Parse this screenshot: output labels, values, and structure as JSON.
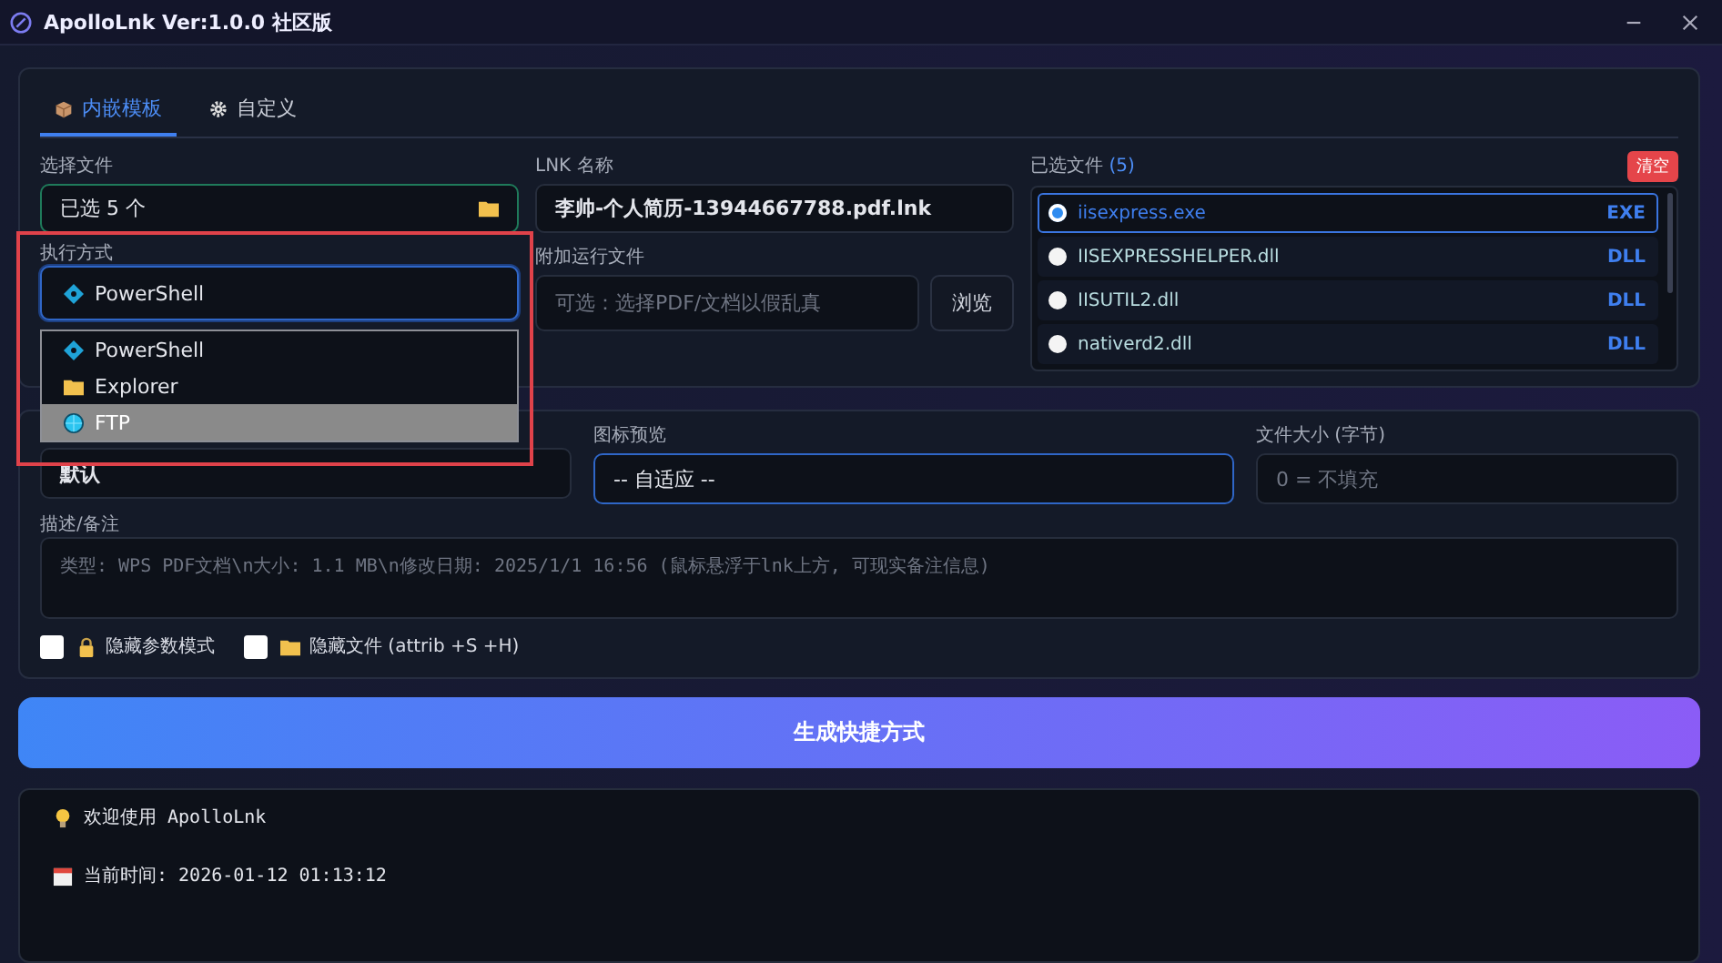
{
  "window": {
    "title": "ApolloLnk Ver:1.0.0 社区版"
  },
  "tabs": [
    {
      "label": "内嵌模板",
      "kind": "box",
      "selected": true
    },
    {
      "label": "自定义",
      "kind": "gear",
      "selected": false
    }
  ],
  "select_file": {
    "label": "选择文件",
    "value": "已选 5 个"
  },
  "lnk_name": {
    "label": "LNK 名称",
    "value": "李帅-个人简历-13944667788.pdf.lnk"
  },
  "exec_mode": {
    "label": "执行方式",
    "value": {
      "label": "PowerShell",
      "kind": "powershell"
    },
    "expanded": true,
    "options": [
      {
        "label": "PowerShell",
        "kind": "powershell",
        "highlighted": false
      },
      {
        "label": "Explorer",
        "kind": "folder",
        "highlighted": false
      },
      {
        "label": "FTP",
        "kind": "globe",
        "highlighted": true
      }
    ]
  },
  "attach_file": {
    "label": "附加运行文件",
    "placeholder": "可选：选择PDF/文档以假乱真",
    "button": "浏览"
  },
  "selected_files": {
    "label": "已选文件",
    "count": "(5)",
    "clear_button": "清空",
    "items": [
      {
        "name": "iisexpress.exe",
        "type": "EXE",
        "selected": true
      },
      {
        "name": "IISEXPRESSHELPER.dll",
        "type": "DLL",
        "selected": false
      },
      {
        "name": "IISUTIL2.dll",
        "type": "DLL",
        "selected": false
      },
      {
        "name": "nativerd2.dll",
        "type": "DLL",
        "selected": false
      }
    ]
  },
  "column_1": {
    "value": "默认"
  },
  "icon_preview": {
    "label": "图标预览",
    "value": "-- 自适应 --"
  },
  "file_size": {
    "label": "文件大小 (字节)",
    "placeholder": "0 = 不填充"
  },
  "description": {
    "label": "描述/备注",
    "placeholder": "类型: WPS PDF文档\\n大小: 1.1 MB\\n修改日期: 2025/1/1 16:56 (鼠标悬浮于lnk上方, 可现实备注信息)"
  },
  "checkboxes": [
    {
      "label": "隐藏参数模式",
      "kind": "lock",
      "checked": false
    },
    {
      "label": "隐藏文件 (attrib +S +H)",
      "kind": "folder",
      "checked": false
    }
  ],
  "generate_button": "生成快捷方式",
  "log": [
    {
      "kind": "bulb",
      "text": "欢迎使用 ApolloLnk"
    },
    {
      "kind": "calendar",
      "text": "当前时间: 2026-01-12 01:13:12"
    }
  ]
}
